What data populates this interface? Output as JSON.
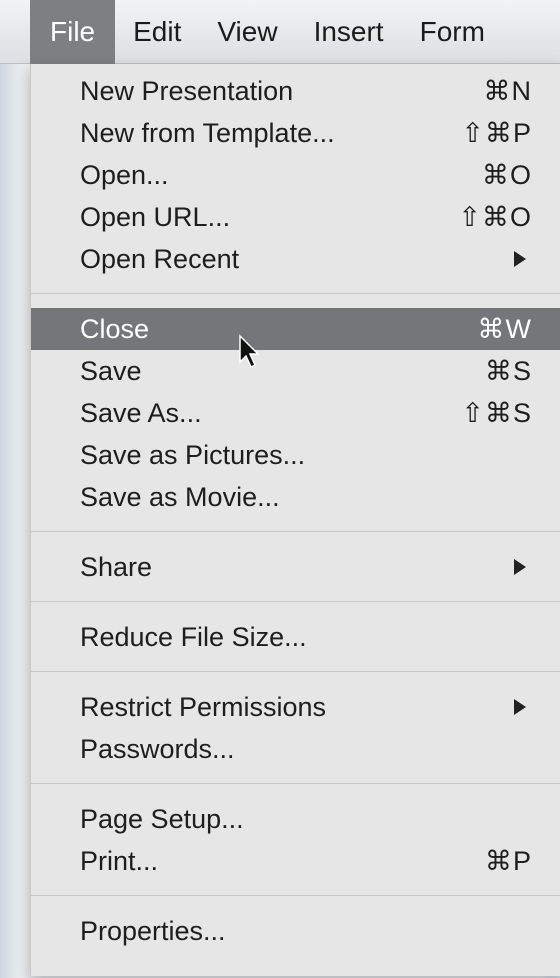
{
  "menubar": {
    "items": [
      {
        "label": "File"
      },
      {
        "label": "Edit"
      },
      {
        "label": "View"
      },
      {
        "label": "Insert"
      },
      {
        "label": "Form"
      }
    ]
  },
  "file_menu": {
    "items": [
      {
        "label": "New Presentation",
        "shortcut": "⌘N"
      },
      {
        "label": "New from Template...",
        "shortcut": "⇧⌘P"
      },
      {
        "label": "Open...",
        "shortcut": "⌘O"
      },
      {
        "label": "Open URL...",
        "shortcut": "⇧⌘O"
      },
      {
        "label": "Open Recent",
        "submenu": true
      },
      {
        "label": "Close",
        "shortcut": "⌘W",
        "highlighted": true
      },
      {
        "label": "Save",
        "shortcut": "⌘S"
      },
      {
        "label": "Save As...",
        "shortcut": "⇧⌘S"
      },
      {
        "label": "Save as Pictures..."
      },
      {
        "label": "Save as Movie..."
      },
      {
        "label": "Share",
        "submenu": true
      },
      {
        "label": "Reduce File Size..."
      },
      {
        "label": "Restrict Permissions",
        "submenu": true
      },
      {
        "label": "Passwords..."
      },
      {
        "label": "Page Setup..."
      },
      {
        "label": "Print...",
        "shortcut": "⌘P"
      },
      {
        "label": "Properties..."
      }
    ]
  },
  "icons": {
    "submenu": "triangle-right-icon",
    "pointer": "mouse-cursor-icon"
  },
  "colors": {
    "highlight": "#747679",
    "menu_background": "#e6e6e6"
  }
}
